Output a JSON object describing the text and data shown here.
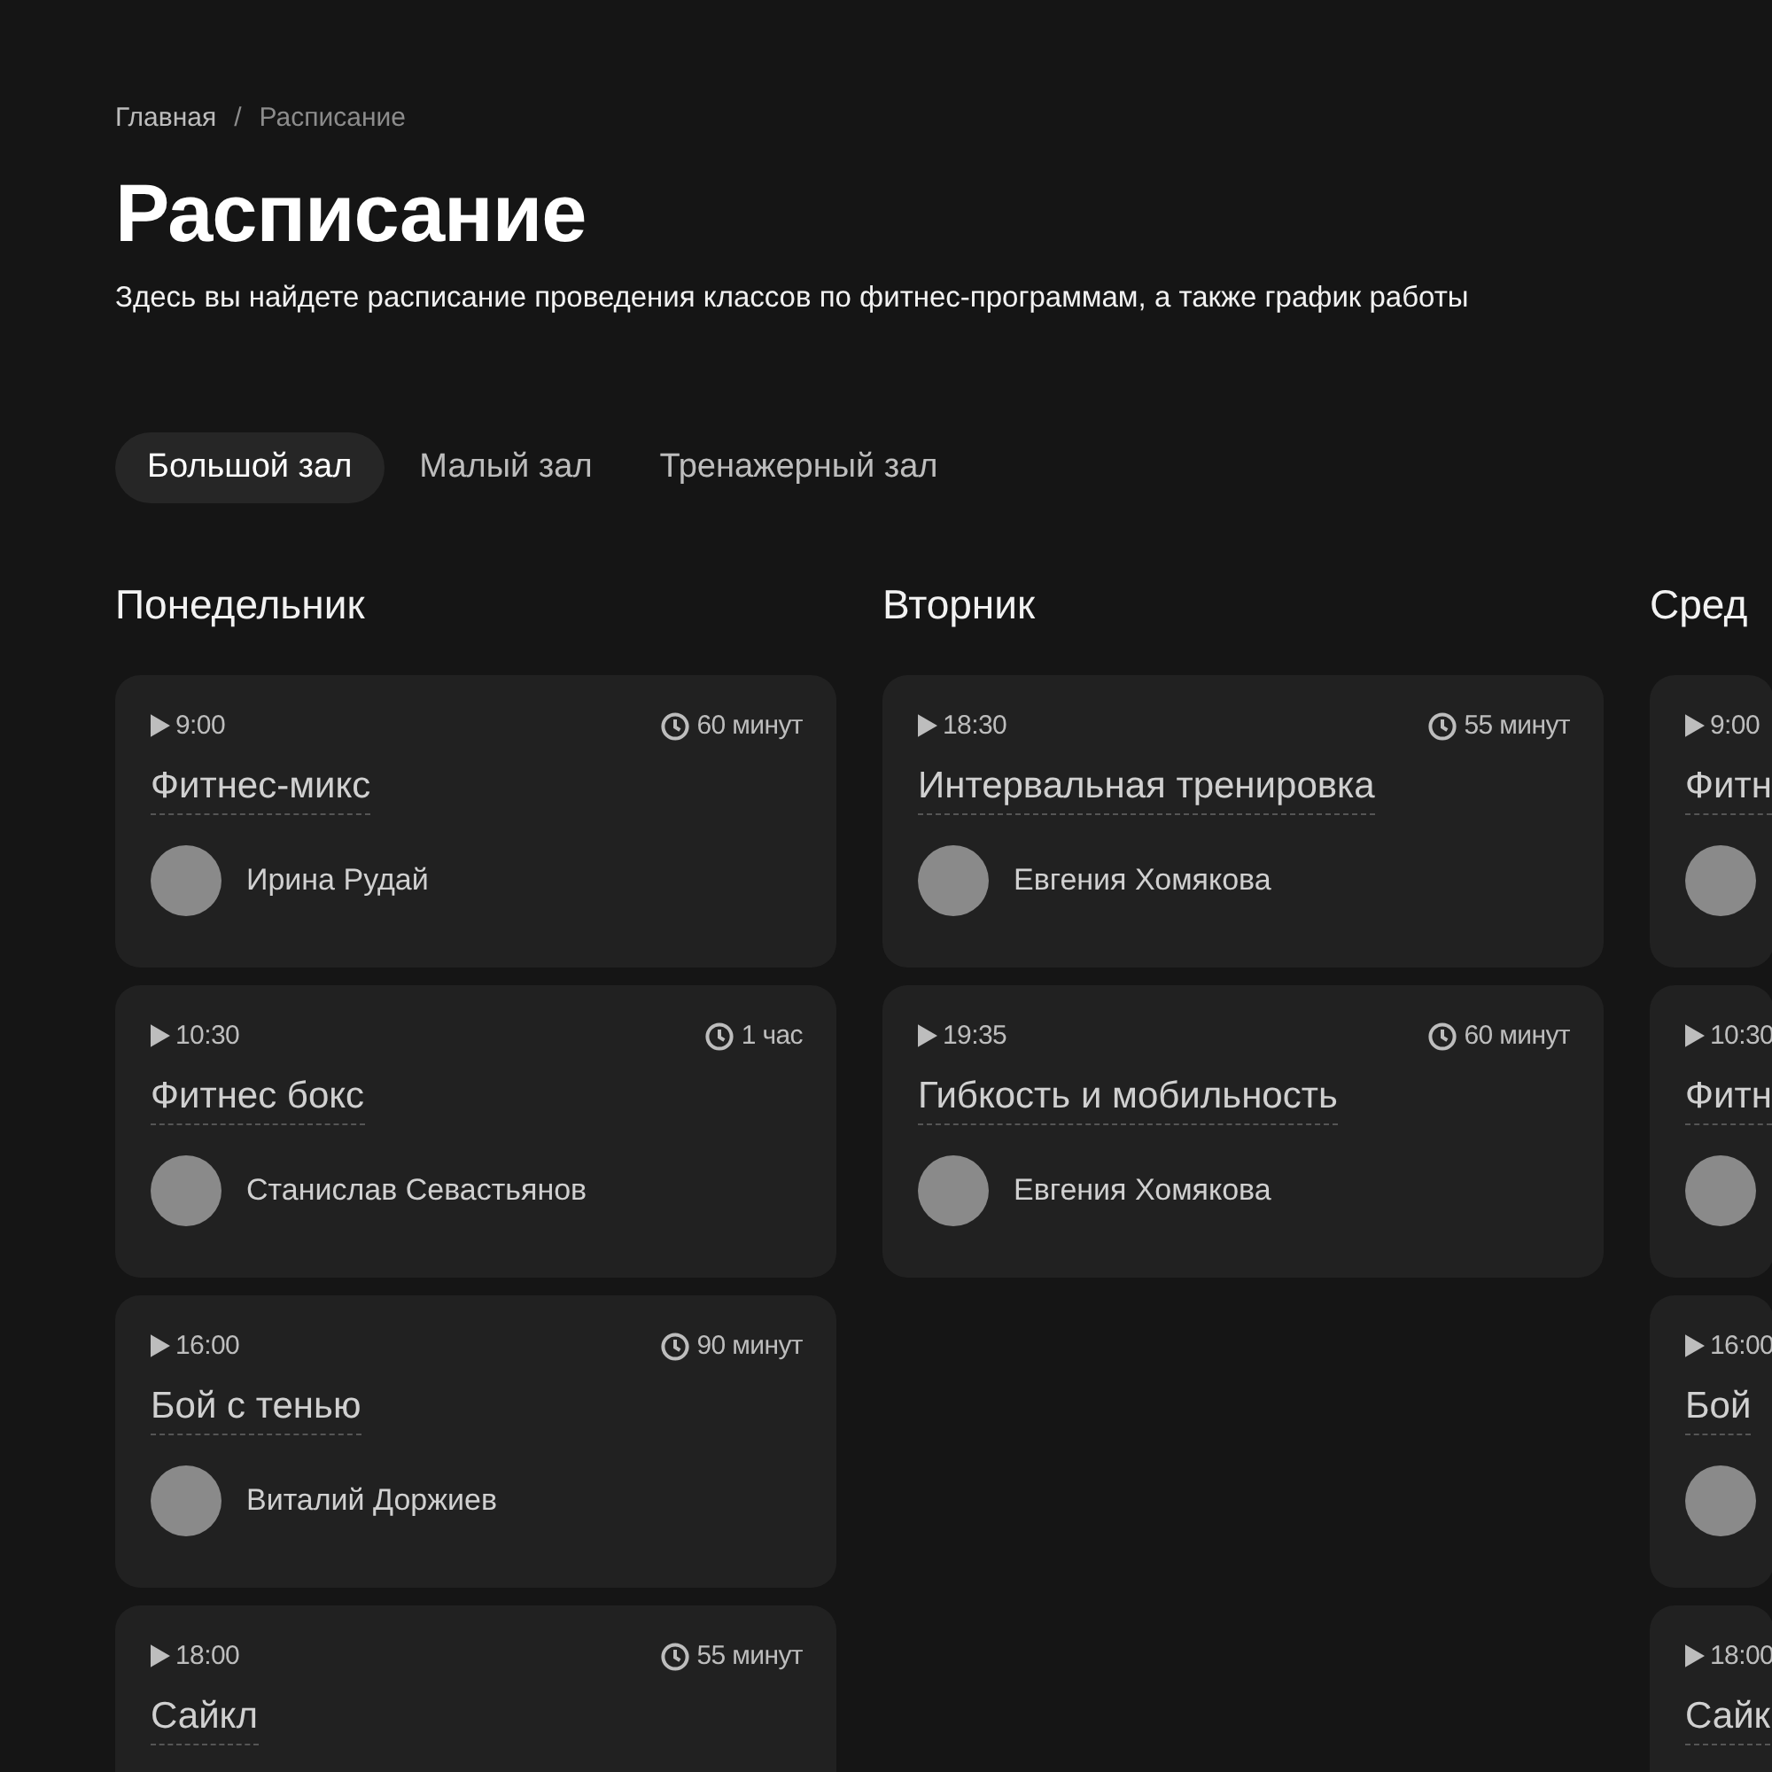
{
  "breadcrumbs": [
    {
      "label": "Главная",
      "current": false
    },
    {
      "label": "Расписание",
      "current": true
    }
  ],
  "breadcrumb_separator": "/",
  "title": "Расписание",
  "description": "Здесь вы найдете расписание проведения классов по фитнес-программам, а также график работы",
  "tabs": [
    {
      "label": "Большой зал",
      "selected": true
    },
    {
      "label": "Малый зал",
      "selected": false
    },
    {
      "label": "Тренажерный зал",
      "selected": false
    }
  ],
  "days": [
    {
      "name": "Понедельник",
      "classes": [
        {
          "time": "9:00",
          "duration": "60 минут",
          "title": "Фитнес-микс",
          "trainer": "Ирина Рудай"
        },
        {
          "time": "10:30",
          "duration": "1 час",
          "title": "Фитнес бокс",
          "trainer": "Станислав Севастьянов"
        },
        {
          "time": "16:00",
          "duration": "90 минут",
          "title": "Бой с тенью",
          "trainer": "Виталий Доржиев"
        },
        {
          "time": "18:00",
          "duration": "55 минут",
          "title": "Сайкл"
        }
      ]
    },
    {
      "name": "Вторник",
      "classes": [
        {
          "time": "18:30",
          "duration": "55 минут",
          "title": "Интервальная тренировка",
          "trainer": "Евгения Хомякова"
        },
        {
          "time": "19:35",
          "duration": "60 минут",
          "title": "Гибкость и мобильность",
          "trainer": "Евгения Хомякова"
        }
      ]
    },
    {
      "name": "Сред",
      "classes": [
        {
          "time": "9:00",
          "title": "Фитн",
          "avatar": true
        },
        {
          "time": "10:30",
          "title": "Фитн",
          "avatar": true
        },
        {
          "time": "16:00",
          "title": "Бой",
          "avatar": true
        },
        {
          "time": "18:00",
          "title": "Сайк"
        }
      ]
    }
  ]
}
